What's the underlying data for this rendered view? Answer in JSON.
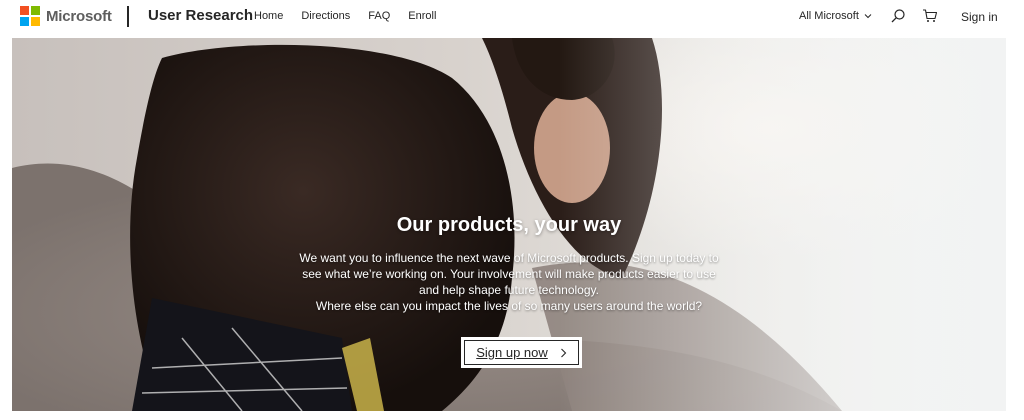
{
  "header": {
    "logo_text": "Microsoft",
    "site_title": "User Research",
    "nav": [
      {
        "label": "Home"
      },
      {
        "label": "Directions"
      },
      {
        "label": "FAQ"
      },
      {
        "label": "Enroll"
      }
    ],
    "all_microsoft": "All Microsoft",
    "sign_in": "Sign in",
    "icons": {
      "search": "search-icon",
      "cart": "cart-icon",
      "chevron": "chevron-down-icon"
    }
  },
  "hero": {
    "title": "Our products, your way",
    "body_lines": [
      "We want you to influence the next wave of Microsoft products. Sign up today to",
      "see what we’re working on. Your involvement will make products easier to use",
      "and help shape future technology.",
      "Where else can you impact the lives of so many users around the world?"
    ],
    "cta_label": "Sign up now"
  },
  "colors": {
    "logo_red": "#f25022",
    "logo_green": "#7fba00",
    "logo_blue": "#00a4ef",
    "logo_yellow": "#ffb900",
    "text": "#262626"
  }
}
